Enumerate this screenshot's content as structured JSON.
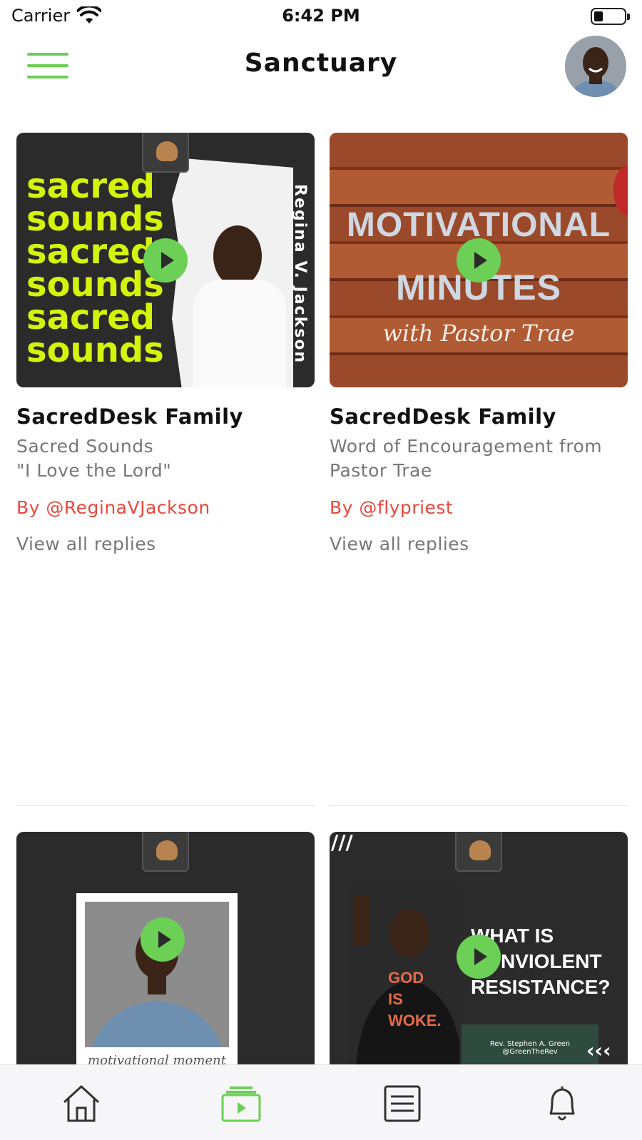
{
  "status_bar": {
    "carrier": "Carrier",
    "time": "6:42 PM"
  },
  "header": {
    "title": "Sanctuary"
  },
  "posts": [
    {
      "title": "SacredDesk Family",
      "description": "Sacred Sounds\n\"I Love the Lord\"",
      "author": "By @ReginaVJackson",
      "replies": "View all replies",
      "artwork": {
        "lines": [
          "sacred",
          "sounds",
          "sacred",
          "sounds",
          "sacred",
          "sounds"
        ],
        "side_name": "Regina V. Jackson"
      }
    },
    {
      "title": "SacredDesk Family",
      "description": "Word of Encouragement from\nPastor Trae",
      "author": "By @flypriest",
      "replies": "View all replies",
      "artwork": {
        "line_1": "MOTIVATIONAL",
        "line_2": "MINUTES",
        "script": "with Pastor Trae"
      }
    },
    {
      "artwork": {
        "caption": "motivational moment"
      }
    },
    {
      "artwork": {
        "line_1": "WHAT IS",
        "line_2": "NONVIOLENT",
        "line_3": "RESISTANCE?",
        "shirt_text": "GOD IS WOKE.",
        "credit_name": "Rev. Stephen A. Green",
        "credit_handle": "@GreenTheRev"
      }
    }
  ],
  "tabs": [
    {
      "name": "home",
      "icon": "home-icon",
      "active": false
    },
    {
      "name": "videos",
      "icon": "video-library-icon",
      "active": true
    },
    {
      "name": "list",
      "icon": "list-icon",
      "active": false
    },
    {
      "name": "notifications",
      "icon": "bell-icon",
      "active": false
    }
  ],
  "colors": {
    "accent": "#6ccf56",
    "author": "#e8493c",
    "lime": "#d4f40c"
  }
}
